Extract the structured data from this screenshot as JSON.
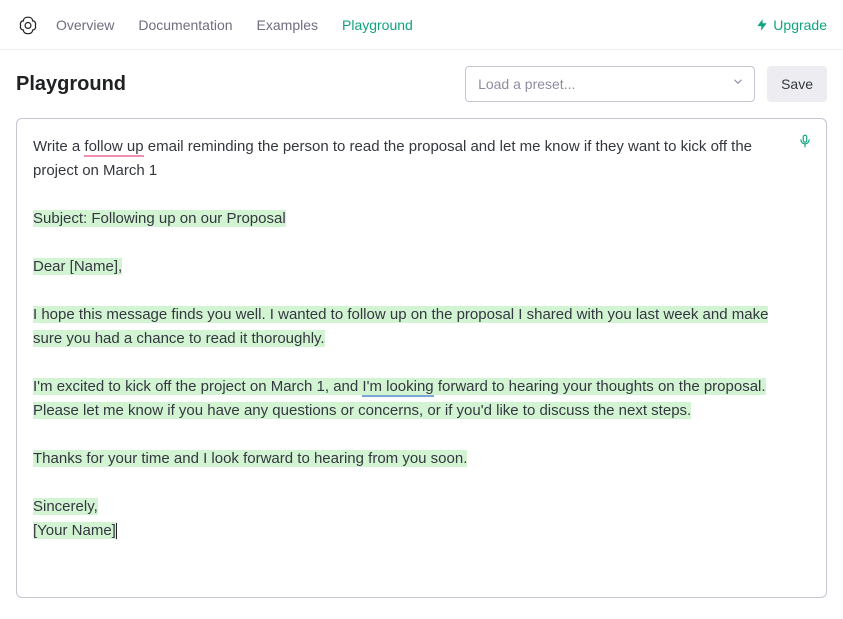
{
  "nav": {
    "items": [
      {
        "label": "Overview",
        "active": false
      },
      {
        "label": "Documentation",
        "active": false
      },
      {
        "label": "Examples",
        "active": false
      },
      {
        "label": "Playground",
        "active": true
      }
    ],
    "upgrade_label": "Upgrade"
  },
  "header": {
    "title": "Playground",
    "preset_placeholder": "Load a preset...",
    "save_label": "Save"
  },
  "editor": {
    "prompt_pre": "Write a ",
    "prompt_underlined": "follow up",
    "prompt_post": " email reminding the person to read the proposal and let me know if they want to kick off the project on March 1",
    "generated": {
      "subject": "Subject: Following up on our Proposal",
      "greeting": "Dear [Name],",
      "para1": "I hope this message finds you well. I wanted to follow up on the proposal I shared with you last week and make sure you had a chance to read it thoroughly.",
      "para2_a": "I'm excited to kick off the project on March 1, and ",
      "para2_underlined": "I'm looking",
      "para2_b": " forward to hearing your thoughts on the proposal. Please let me know if you have any questions or concerns, or if you'd like to discuss the next steps.",
      "para3": "Thanks for your time and I look forward to hearing from you soon.",
      "signoff1": "Sincerely,",
      "signoff2": "[Your Name]"
    }
  },
  "colors": {
    "accent": "#10a37f",
    "highlight": "#d2f4d3",
    "underline_spell": "#f08eb3",
    "underline_grammar": "#7aa9d6"
  }
}
